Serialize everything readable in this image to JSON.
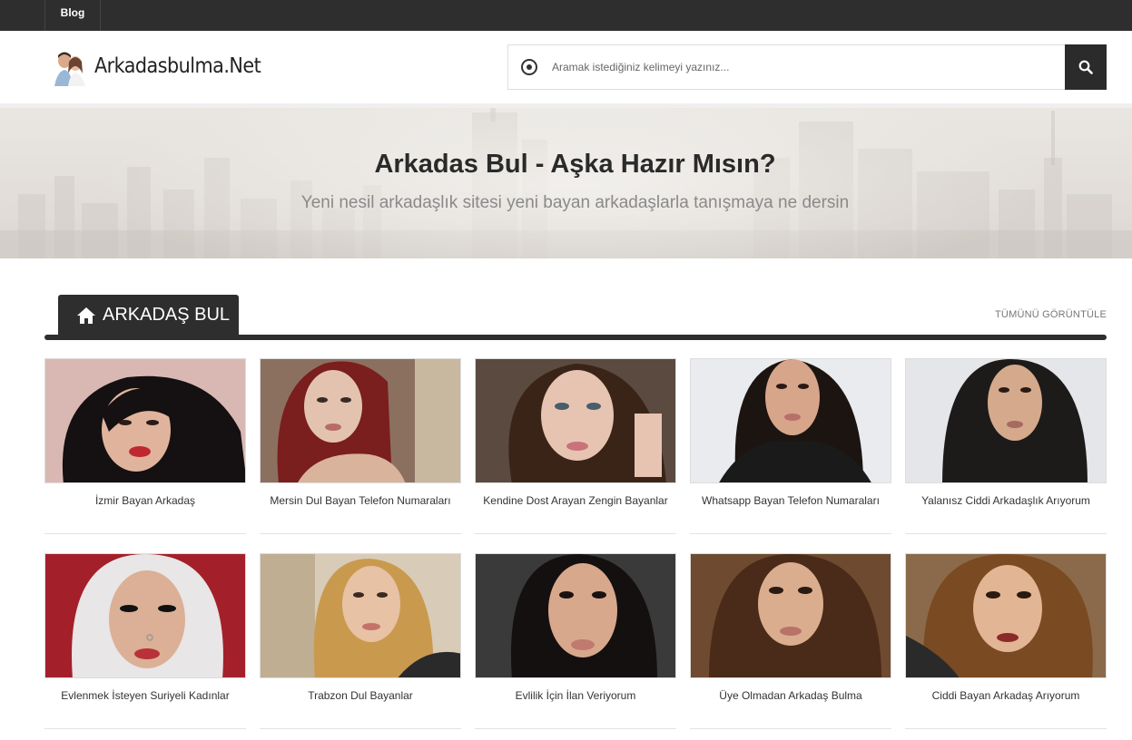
{
  "topbar": {
    "nav": [
      {
        "label": "Blog"
      }
    ]
  },
  "header": {
    "logo_text": "Arkadasbulma.Net",
    "search_placeholder": "Aramak istediğiniz kelimeyi yazınız..."
  },
  "hero": {
    "title": "Arkadas Bul - Aşka Hazır Mısın?",
    "subtitle": "Yeni nesil arkadaşlık sitesi yeni bayan arkadaşlarla tanışmaya ne dersin"
  },
  "section": {
    "title": "ARKADAŞ BUL",
    "view_all": "TÜMÜNÜ GÖRÜNTÜLE"
  },
  "cards": [
    {
      "caption": "İzmir Bayan Arkadaş"
    },
    {
      "caption": "Mersin Dul Bayan Telefon Numaraları"
    },
    {
      "caption": "Kendine Dost Arayan Zengin Bayanlar"
    },
    {
      "caption": "Whatsapp Bayan Telefon Numaraları"
    },
    {
      "caption": "Yalanısz Ciddi Arkadaşlık Arıyorum"
    },
    {
      "caption": "Evlenmek İsteyen Suriyeli Kadınlar"
    },
    {
      "caption": "Trabzon Dul Bayanlar"
    },
    {
      "caption": "Evlilik İçin İlan Veriyorum"
    },
    {
      "caption": "Üye Olmadan Arkadaş Bulma"
    },
    {
      "caption": "Ciddi Bayan Arkadaş Arıyorum"
    }
  ],
  "colors": {
    "dark": "#2e2e2e",
    "accent_lips": "#c0282f"
  },
  "icons": {
    "search": "search-icon",
    "home": "home-icon",
    "radio": "radio-icon"
  }
}
